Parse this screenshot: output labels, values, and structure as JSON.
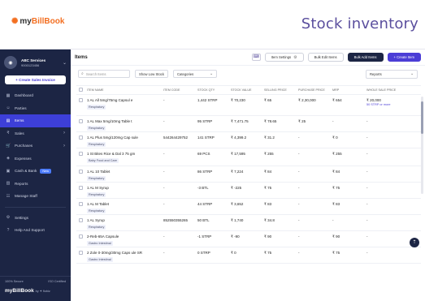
{
  "brand": {
    "logo_mark": "✺",
    "my": "my",
    "bill": "BillBook"
  },
  "headline": "Stock inventory",
  "sidebar": {
    "business_name": "ABC Services",
    "business_phone": "9000123456",
    "create_sales_invoice": "+ Create Sales Invoice",
    "items": [
      {
        "label": "Dashboard",
        "icon": "dashboard-icon"
      },
      {
        "label": "Parties",
        "icon": "parties-icon"
      },
      {
        "label": "Items",
        "icon": "items-icon",
        "active": true
      },
      {
        "label": "Sales",
        "icon": "sales-icon",
        "chevron": true
      },
      {
        "label": "Purchases",
        "icon": "purchases-icon",
        "chevron": true
      },
      {
        "label": "Expenses",
        "icon": "expenses-icon"
      },
      {
        "label": "Cash & Bank",
        "icon": "bank-icon",
        "tag": "New"
      },
      {
        "label": "Reports",
        "icon": "reports-icon"
      },
      {
        "label": "Manage Staff",
        "icon": "staff-icon"
      }
    ],
    "bottom_items": [
      {
        "label": "Settings",
        "icon": "settings-icon"
      },
      {
        "label": "Help And Support",
        "icon": "help-icon"
      }
    ],
    "footer": {
      "secure": "100% Secure",
      "iso": "ISO Certified",
      "logo": "myBillBook",
      "by": "by ✦ flobiz"
    }
  },
  "main": {
    "title": "Items",
    "item_settings": "Item Settings",
    "bulk_edit": "Bulk Edit Items",
    "bulk_add": "Bulk Add Items",
    "create_item": "+ Create Item",
    "search_placeholder": "Search Items",
    "show_low_stock": "Show Low Stock",
    "categories": "Categories",
    "reports": "Reports"
  },
  "table": {
    "headers": [
      "ITEM NAME",
      "ITEM CODE",
      "STOCK QTY",
      "STOCK VALUE",
      "SELLING PRICE",
      "PURCHASE PRICE",
      "MRP",
      "WHOLE SALE PRICE"
    ],
    "rows": [
      {
        "name": "1 AL All 5mg/75mg Capsul e",
        "category": "Respiratory",
        "code": "-",
        "qty": "1,442 STRP",
        "value": "₹ 70,230",
        "sell": "₹ 65",
        "purchase": "₹ 2,30,000",
        "mrp": "₹ 654",
        "wholesale": "₹ 20,000",
        "wholesale_sub": "50 STRP or more"
      },
      {
        "name": "1 AL Max 5mg/10mg Table t",
        "category": "Respiratory",
        "code": "-",
        "qty": "95 STRP",
        "value": "₹ 7,471.75",
        "sell": "₹ 78.65",
        "purchase": "₹ 25",
        "mrp": "-",
        "wholesale": "-",
        "wholesale_sub": ""
      },
      {
        "name": "1 AL Plus 5mg/120mg Cap sule",
        "category": "Respiratory",
        "code": "544264429752",
        "qty": "141 STRP",
        "value": "₹ 4,399.2",
        "sell": "₹ 31.2",
        "purchase": "-",
        "mrp": "₹ 0",
        "wholesale": "-",
        "wholesale_sub": ""
      },
      {
        "name": "1 St Bites Rice & Dal 3 75 gm",
        "category": "Baby Food and Care",
        "code": "-",
        "qty": "69 PCS",
        "value": "₹ 17,595",
        "sell": "₹ 255",
        "purchase": "-",
        "mrp": "₹ 255",
        "wholesale": "-",
        "wholesale_sub": ""
      },
      {
        "name": "1 AL 10 Tablet",
        "category": "Respiratory",
        "code": "-",
        "qty": "86 STRP",
        "value": "₹ 7,224",
        "sell": "₹ 84",
        "purchase": "-",
        "mrp": "₹ 84",
        "wholesale": "-",
        "wholesale_sub": ""
      },
      {
        "name": "1 AL M Syrup",
        "category": "Respiratory",
        "code": "-",
        "qty": "-3 BTL",
        "value": "₹ -225",
        "sell": "₹ 75",
        "purchase": "-",
        "mrp": "₹ 75",
        "wholesale": "-",
        "wholesale_sub": ""
      },
      {
        "name": "1 AL M Tablet",
        "category": "Respiratory",
        "code": "-",
        "qty": "44 STRP",
        "value": "₹ 3,652",
        "sell": "₹ 83",
        "purchase": "-",
        "mrp": "₹ 83",
        "wholesale": "-",
        "wholesale_sub": ""
      },
      {
        "name": "1 AL Syrup",
        "category": "Respiratory",
        "code": "852550355265",
        "qty": "50 BTL",
        "value": "₹ 1,740",
        "sell": "₹ 34.8",
        "purchase": "-",
        "mrp": "-",
        "wholesale": "-",
        "wholesale_sub": ""
      },
      {
        "name": "2-Reb-65A Capsule",
        "category": "Gastro Intestinal",
        "code": "-",
        "qty": "-1 STRP",
        "value": "₹ -90",
        "sell": "₹ 90",
        "purchase": "-",
        "mrp": "₹ 90",
        "wholesale": "-",
        "wholesale_sub": ""
      },
      {
        "name": "2 Zole 0-30mg/30mg Caps ule SR",
        "category": "Gastro Intestinal",
        "code": "-",
        "qty": "0 STRP",
        "value": "₹ 0",
        "sell": "₹ 75",
        "purchase": "-",
        "mrp": "₹ 75",
        "wholesale": "-",
        "wholesale_sub": ""
      }
    ]
  }
}
